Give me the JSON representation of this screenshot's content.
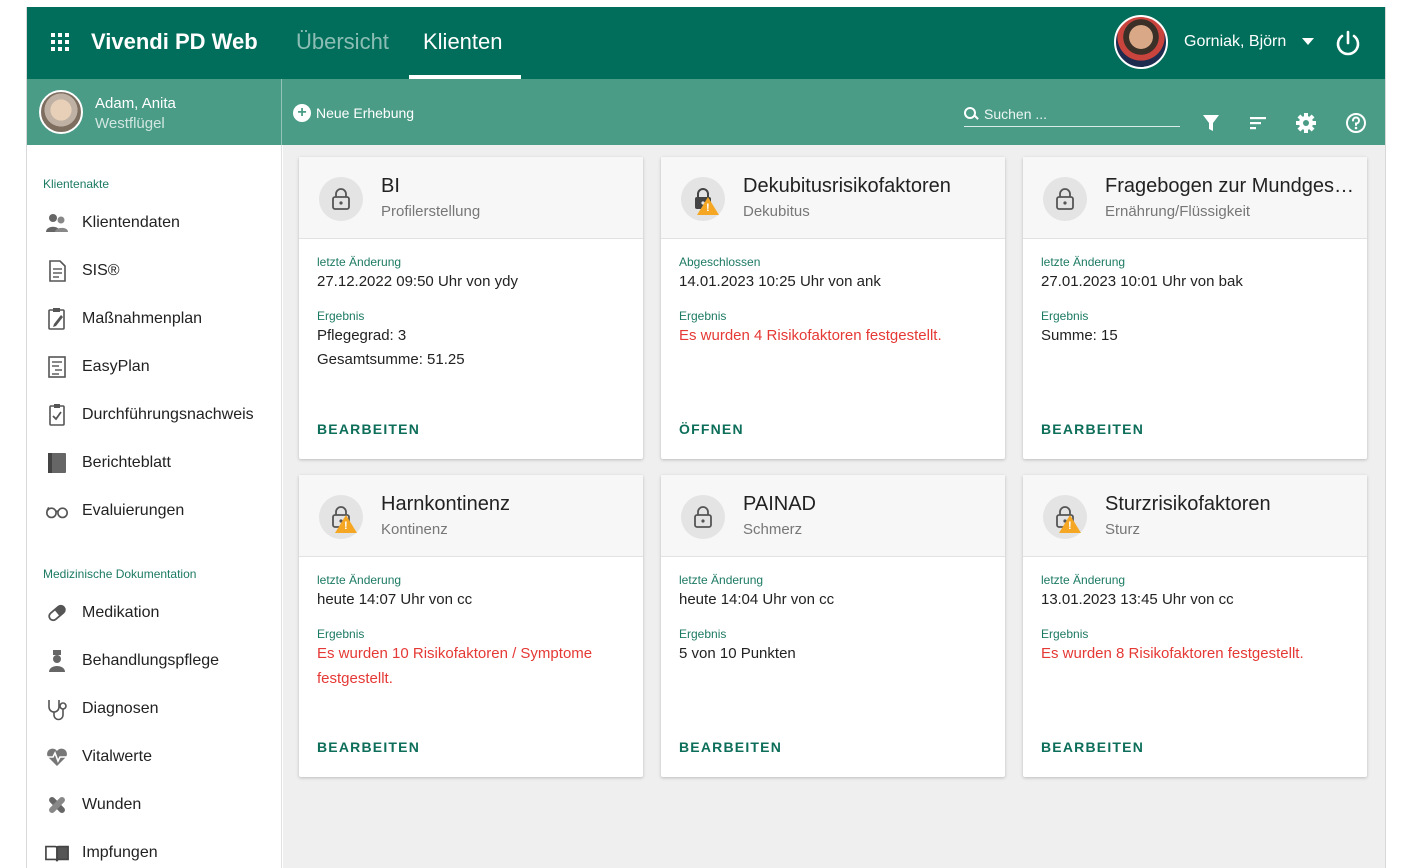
{
  "header": {
    "app_title": "Vivendi PD Web",
    "tabs": [
      {
        "label": "Übersicht",
        "active": false
      },
      {
        "label": "Klienten",
        "active": true
      }
    ],
    "user_name": "Gorniak, Björn"
  },
  "client": {
    "name": "Adam, Anita",
    "ward": "Westflügel"
  },
  "toolbar": {
    "new_label": "Neue Erhebung",
    "search_placeholder": "Suchen ..."
  },
  "sidebar": {
    "sections": [
      {
        "label": "Klientenakte",
        "items": [
          {
            "label": "Klientendaten",
            "icon": "people-icon"
          },
          {
            "label": "SIS®",
            "icon": "document-icon"
          },
          {
            "label": "Maßnahmenplan",
            "icon": "edit-document-icon"
          },
          {
            "label": "EasyPlan",
            "icon": "list-document-icon"
          },
          {
            "label": "Durchführungsnachweis",
            "icon": "clipboard-check-icon"
          },
          {
            "label": "Berichteblatt",
            "icon": "notebook-icon"
          },
          {
            "label": "Evaluierungen",
            "icon": "glasses-icon"
          }
        ]
      },
      {
        "label": "Medizinische Dokumentation",
        "items": [
          {
            "label": "Medikation",
            "icon": "pill-icon"
          },
          {
            "label": "Behandlungspflege",
            "icon": "nurse-icon"
          },
          {
            "label": "Diagnosen",
            "icon": "stethoscope-icon"
          },
          {
            "label": "Vitalwerte",
            "icon": "heartbeat-icon"
          },
          {
            "label": "Wunden",
            "icon": "bandage-icon"
          },
          {
            "label": "Impfungen",
            "icon": "book-icon"
          }
        ]
      }
    ]
  },
  "cards": [
    {
      "title": "BI",
      "subtitle": "Profilerstellung",
      "warning": false,
      "date_label": "letzte Änderung",
      "date_value": "27.12.2022 09:50 Uhr von ydy",
      "result_label": "Ergebnis",
      "result_lines": [
        "Pflegegrad: 3",
        "Gesamtsumme: 51.25"
      ],
      "result_alert": false,
      "action": "BEARBEITEN"
    },
    {
      "title": "Dekubitusrisikofaktoren",
      "subtitle": "Dekubitus",
      "warning": true,
      "locked_dark": true,
      "date_label": "Abgeschlossen",
      "date_value": "14.01.2023  10:25 Uhr von ank",
      "result_label": "Ergebnis",
      "result_lines": [
        "Es wurden 4 Risikofaktoren festgestellt."
      ],
      "result_alert": true,
      "action": "ÖFFNEN"
    },
    {
      "title": "Fragebogen zur Mundgesundheit",
      "subtitle": "Ernährung/Flüssigkeit",
      "warning": false,
      "date_label": "letzte Änderung",
      "date_value": "27.01.2023  10:01 Uhr von bak",
      "result_label": "Ergebnis",
      "result_lines": [
        "Summe: 15"
      ],
      "result_alert": false,
      "action": "BEARBEITEN"
    },
    {
      "title": "Harnkontinenz",
      "subtitle": "Kontinenz",
      "warning": true,
      "date_label": "letzte Änderung",
      "date_value": "heute 14:07 Uhr von cc",
      "result_label": "Ergebnis",
      "result_lines": [
        "Es wurden 10 Risikofaktoren / Symptome festgestellt."
      ],
      "result_alert": true,
      "action": "BEARBEITEN"
    },
    {
      "title": "PAINAD",
      "subtitle": "Schmerz",
      "warning": false,
      "date_label": "letzte Änderung",
      "date_value": "heute 14:04 Uhr von cc",
      "result_label": "Ergebnis",
      "result_lines": [
        "5 von 10 Punkten"
      ],
      "result_alert": false,
      "action": "BEARBEITEN"
    },
    {
      "title": "Sturzrisikofaktoren",
      "subtitle": "Sturz",
      "warning": true,
      "date_label": "letzte Änderung",
      "date_value": "13.01.2023 13:45 Uhr von cc",
      "result_label": "Ergebnis",
      "result_lines": [
        "Es wurden 8 Risikofaktoren festgestellt."
      ],
      "result_alert": true,
      "action": "BEARBEITEN"
    }
  ],
  "colors": {
    "primary": "#006e5a",
    "secondary": "#4a9c86",
    "accent_text": "#1c7a63",
    "alert": "#e53935",
    "warning": "#f5a623"
  }
}
